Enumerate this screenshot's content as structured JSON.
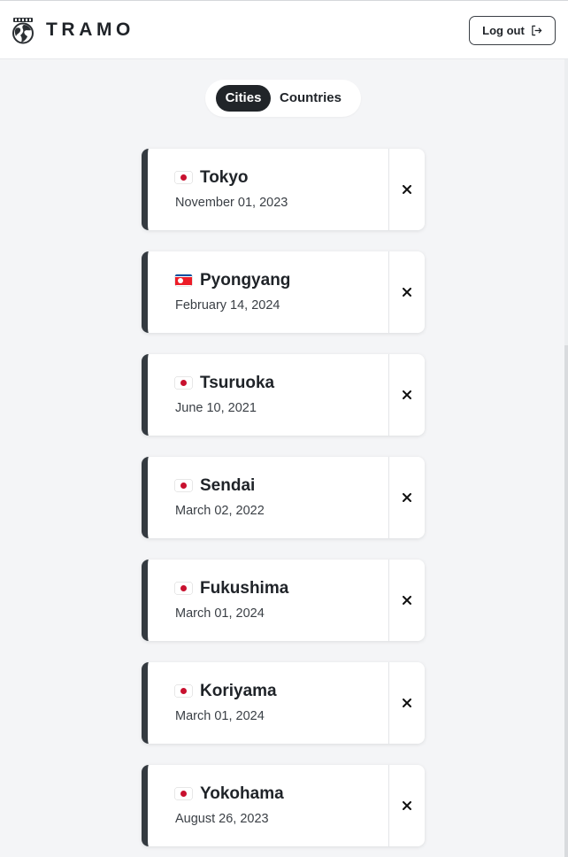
{
  "header": {
    "brand": "TRAMO",
    "logout_label": "Log out"
  },
  "tabs": {
    "cities_label": "Cities",
    "countries_label": "Countries",
    "active": "Cities"
  },
  "cities": [
    {
      "name": "Tokyo",
      "date": "November 01, 2023",
      "flag": "japan-flag-icon"
    },
    {
      "name": "Pyongyang",
      "date": "February 14, 2024",
      "flag": "north-korea-flag-icon"
    },
    {
      "name": "Tsuruoka",
      "date": "June 10, 2021",
      "flag": "japan-flag-icon"
    },
    {
      "name": "Sendai",
      "date": "March 02, 2022",
      "flag": "japan-flag-icon"
    },
    {
      "name": "Fukushima",
      "date": "March 01, 2024",
      "flag": "japan-flag-icon"
    },
    {
      "name": "Koriyama",
      "date": "March 01, 2024",
      "flag": "japan-flag-icon"
    },
    {
      "name": "Yokohama",
      "date": "August 26, 2023",
      "flag": "japan-flag-icon"
    }
  ],
  "colors": {
    "accent": "#343a40",
    "background": "#f4f5f7",
    "active_tab": "#212529"
  }
}
